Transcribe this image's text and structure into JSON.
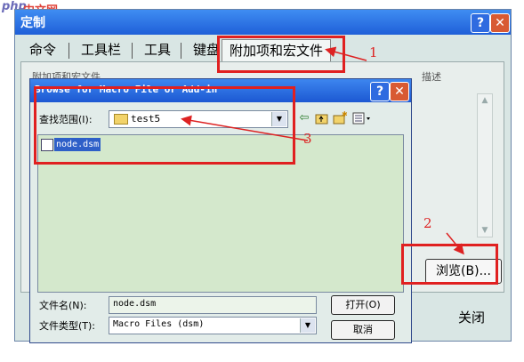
{
  "watermark": {
    "logo_text": "php",
    "site_text": "中文网"
  },
  "outer_dialog": {
    "title": "定制",
    "help_button": "?",
    "close_button": "✕",
    "tabs": [
      {
        "label": "命令"
      },
      {
        "label": "工具栏"
      },
      {
        "label": "工具"
      },
      {
        "label": "键盘"
      },
      {
        "label": "附加项和宏文件"
      }
    ],
    "active_tab": "附加项和宏文件",
    "hidden_label_left": "附加项和宏文件",
    "hidden_label_right": "描述",
    "browse_button": "浏览(B)...",
    "close_label": "关闭"
  },
  "browse_dialog": {
    "title": "Browse for Macro File or Add-in",
    "help_button": "?",
    "close_button": "✕",
    "look_in_label": "查找范围(I):",
    "look_in_value": "test5",
    "files": [
      {
        "name": "node.dsm"
      }
    ],
    "filename_label": "文件名(N):",
    "filename_value": "node.dsm",
    "filetype_label": "文件类型(T):",
    "filetype_value": "Macro Files (dsm)",
    "open_button": "打开(O)",
    "cancel_button": "取消"
  },
  "annotations": {
    "one": "1",
    "two": "2",
    "three": "3"
  },
  "colors": {
    "title_bar": "#1f5fd8",
    "annotation": "#e02020",
    "dialog_bg": "#e2ece9"
  },
  "icons": [
    "back-arrow-icon",
    "up-folder-icon",
    "new-folder-icon",
    "view-menu-icon",
    "folder-icon",
    "file-icon"
  ]
}
